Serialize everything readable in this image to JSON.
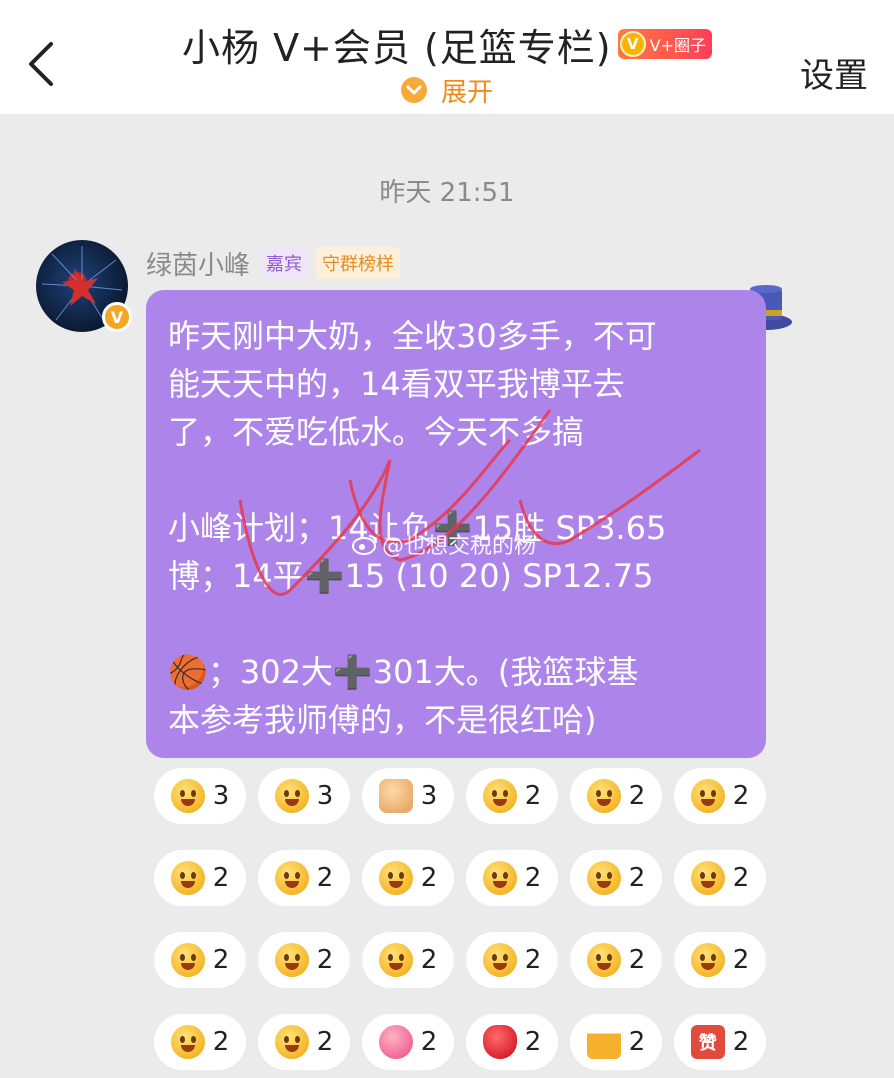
{
  "header": {
    "title": "小杨 V+会员 (足篮专栏)",
    "badge_label": "V+圈子",
    "expand_label": "展开",
    "settings_label": "设置"
  },
  "chat": {
    "timestamp": "昨天 21:51",
    "message": {
      "sender": "绿茵小峰",
      "tags": [
        "嘉宾",
        "守群榜样"
      ],
      "para1": "昨天刚中大奶，全收30多手，不可\n能天天中的，14看双平我博平去\n了，不爱吃低水。今天不多搞",
      "para2": "小峰计划；14让负➕15胜 SP3.65\n博；14平➕15 (10 20) SP12.75",
      "para3": "🏀；302大➕301大。(我篮球基\n本参考我师傅的，不是很红哈)",
      "watermark": "@也想交税的杨"
    },
    "reactions": [
      {
        "icon": "shy-face",
        "count": "3"
      },
      {
        "icon": "surprised-face",
        "count": "3"
      },
      {
        "icon": "thumbs-up",
        "count": "3"
      },
      {
        "icon": "grin-face",
        "count": "2"
      },
      {
        "icon": "laugh-face",
        "count": "2"
      },
      {
        "icon": "kiss-face",
        "count": "2"
      },
      {
        "icon": "shock-face",
        "count": "2"
      },
      {
        "icon": "heart-eyes-face",
        "count": "2"
      },
      {
        "icon": "666-face",
        "count": "2"
      },
      {
        "icon": "smirk-face",
        "count": "2"
      },
      {
        "icon": "cheer-face",
        "count": "2"
      },
      {
        "icon": "rainbow-face",
        "count": "2"
      },
      {
        "icon": "flower-face",
        "count": "2"
      },
      {
        "icon": "love-face",
        "count": "2"
      },
      {
        "icon": "cute-face",
        "count": "2"
      },
      {
        "icon": "think-face",
        "count": "2"
      },
      {
        "icon": "wink-face",
        "count": "2"
      },
      {
        "icon": "cry-laugh-face",
        "count": "2"
      },
      {
        "icon": "headband-face",
        "count": "2"
      },
      {
        "icon": "hero-face",
        "count": "2"
      },
      {
        "icon": "pink-heart",
        "count": "2"
      },
      {
        "icon": "red-heart",
        "count": "2"
      },
      {
        "icon": "beer-cheers",
        "count": "2"
      },
      {
        "icon": "zan-badge",
        "count": "2"
      }
    ],
    "zan_char": "赞"
  }
}
